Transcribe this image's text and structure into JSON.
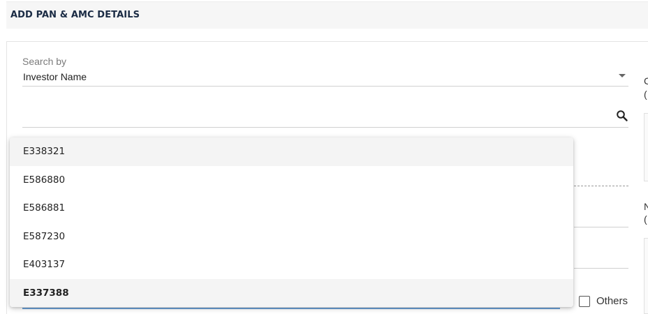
{
  "header": {
    "title": "ADD PAN & AMC DETAILS"
  },
  "search_by": {
    "label": "Search by",
    "value": "Investor Name"
  },
  "search": {
    "value": "",
    "placeholder": ""
  },
  "dropdown": {
    "options": [
      {
        "label": "E338321"
      },
      {
        "label": "E586880"
      },
      {
        "label": "E586881"
      },
      {
        "label": "E587230"
      },
      {
        "label": "E403137"
      },
      {
        "label": "E337388"
      }
    ],
    "highlighted_index": 0,
    "selected_index": 5
  },
  "others": {
    "label": "Others",
    "checked": false
  },
  "right_column": {
    "label_1": "C",
    "label_1_sub": "(",
    "label_2": "N",
    "label_2_sub": "("
  },
  "icons": {
    "search": "search-icon",
    "dropdown_caret": "chevron-down-icon"
  },
  "colors": {
    "title": "#1a2b44",
    "focus_underline": "#6aa0d8",
    "hover_bg": "#f4f4f4"
  }
}
